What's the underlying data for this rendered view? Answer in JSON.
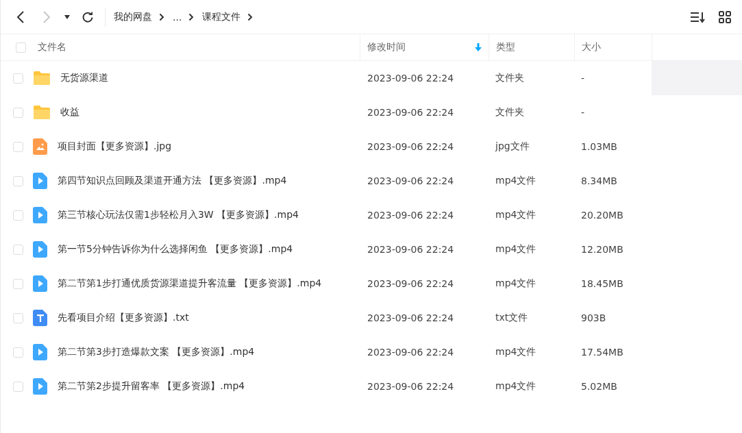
{
  "breadcrumb": [
    "我的网盘",
    "...",
    "课程文件"
  ],
  "table": {
    "select_all_checked": false,
    "columns": [
      {
        "label": "文件名",
        "sorted": false
      },
      {
        "label": "修改时间",
        "sorted": true
      },
      {
        "label": "类型",
        "sorted": false
      },
      {
        "label": "大小",
        "sorted": false
      }
    ],
    "rows": [
      {
        "kind": "folder",
        "name": "无货源渠道",
        "time": "2023-09-06 22:24",
        "type": "文件夹",
        "size": "-",
        "checked": false,
        "hovered": true
      },
      {
        "kind": "folder",
        "name": "收益",
        "time": "2023-09-06 22:24",
        "type": "文件夹",
        "size": "-",
        "checked": false,
        "hovered": false
      },
      {
        "kind": "image",
        "name": "项目封面【更多资源】.jpg",
        "time": "2023-09-06 22:24",
        "type": "jpg文件",
        "size": "1.03MB",
        "checked": false,
        "hovered": false
      },
      {
        "kind": "video",
        "name": "第四节知识点回顾及渠道开通方法 【更多资源】.mp4",
        "time": "2023-09-06 22:24",
        "type": "mp4文件",
        "size": "8.34MB",
        "checked": false,
        "hovered": false
      },
      {
        "kind": "video",
        "name": "第三节核心玩法仅需1步轻松月入3W 【更多资源】.mp4",
        "time": "2023-09-06 22:24",
        "type": "mp4文件",
        "size": "20.20MB",
        "checked": false,
        "hovered": false
      },
      {
        "kind": "video",
        "name": "第一节5分钟告诉你为什么选择闲鱼 【更多资源】.mp4",
        "time": "2023-09-06 22:24",
        "type": "mp4文件",
        "size": "12.20MB",
        "checked": false,
        "hovered": false
      },
      {
        "kind": "video",
        "name": "第二节第1步打通优质货源渠道提升客流量 【更多资源】.mp4",
        "time": "2023-09-06 22:24",
        "type": "mp4文件",
        "size": "18.45MB",
        "checked": false,
        "hovered": false
      },
      {
        "kind": "text",
        "name": "先看项目介绍【更多资源】.txt",
        "time": "2023-09-06 22:24",
        "type": "txt文件",
        "size": "903B",
        "checked": false,
        "hovered": false
      },
      {
        "kind": "video",
        "name": "第二节第3步打造爆款文案 【更多资源】.mp4",
        "time": "2023-09-06 22:24",
        "type": "mp4文件",
        "size": "17.54MB",
        "checked": false,
        "hovered": false
      },
      {
        "kind": "video",
        "name": "第二节第2步提升留客率 【更多资源】.mp4",
        "time": "2023-09-06 22:24",
        "type": "mp4文件",
        "size": "5.02MB",
        "checked": false,
        "hovered": false
      }
    ]
  }
}
